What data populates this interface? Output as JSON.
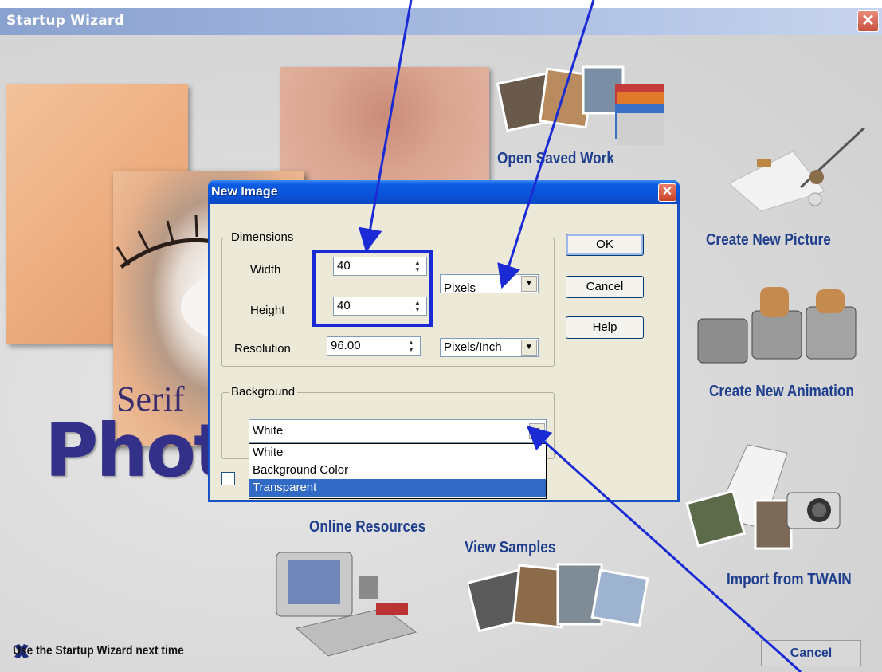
{
  "wizard": {
    "title": "Startup Wizard",
    "close_glyph": "✕",
    "brand_serif": "Serif",
    "brand_photo": "Phot",
    "options": {
      "open_saved_work": "Open Saved Work",
      "create_new_picture": "Create New Picture",
      "create_new_animation": "Create New Animation",
      "import_from_twain": "Import from TWAIN",
      "online_resources": "Online Resources",
      "view_samples": "View Samples"
    },
    "use_wizard_label": "Use the Startup Wizard next time",
    "cancel_label": "Cancel"
  },
  "dialog": {
    "title": "New Image",
    "close_glyph": "✕",
    "dimensions": {
      "legend": "Dimensions",
      "width_label": "Width",
      "width_value": "40",
      "height_label": "Height",
      "height_value": "40",
      "resolution_label": "Resolution",
      "resolution_value": "96.00",
      "units_value": "Pixels",
      "res_units_value": "Pixels/Inch"
    },
    "background": {
      "legend": "Background",
      "selected": "White",
      "options": [
        "White",
        "Background Color",
        "Transparent"
      ],
      "highlighted_option": "Transparent"
    },
    "buttons": {
      "ok": "OK",
      "cancel": "Cancel",
      "help": "Help"
    }
  },
  "colors": {
    "annotation_blue": "#1a2bd6",
    "xp_title_blue": "#0b5ce2",
    "wizard_option_text": "#1f3f8e",
    "selection_blue": "#316ac5"
  }
}
